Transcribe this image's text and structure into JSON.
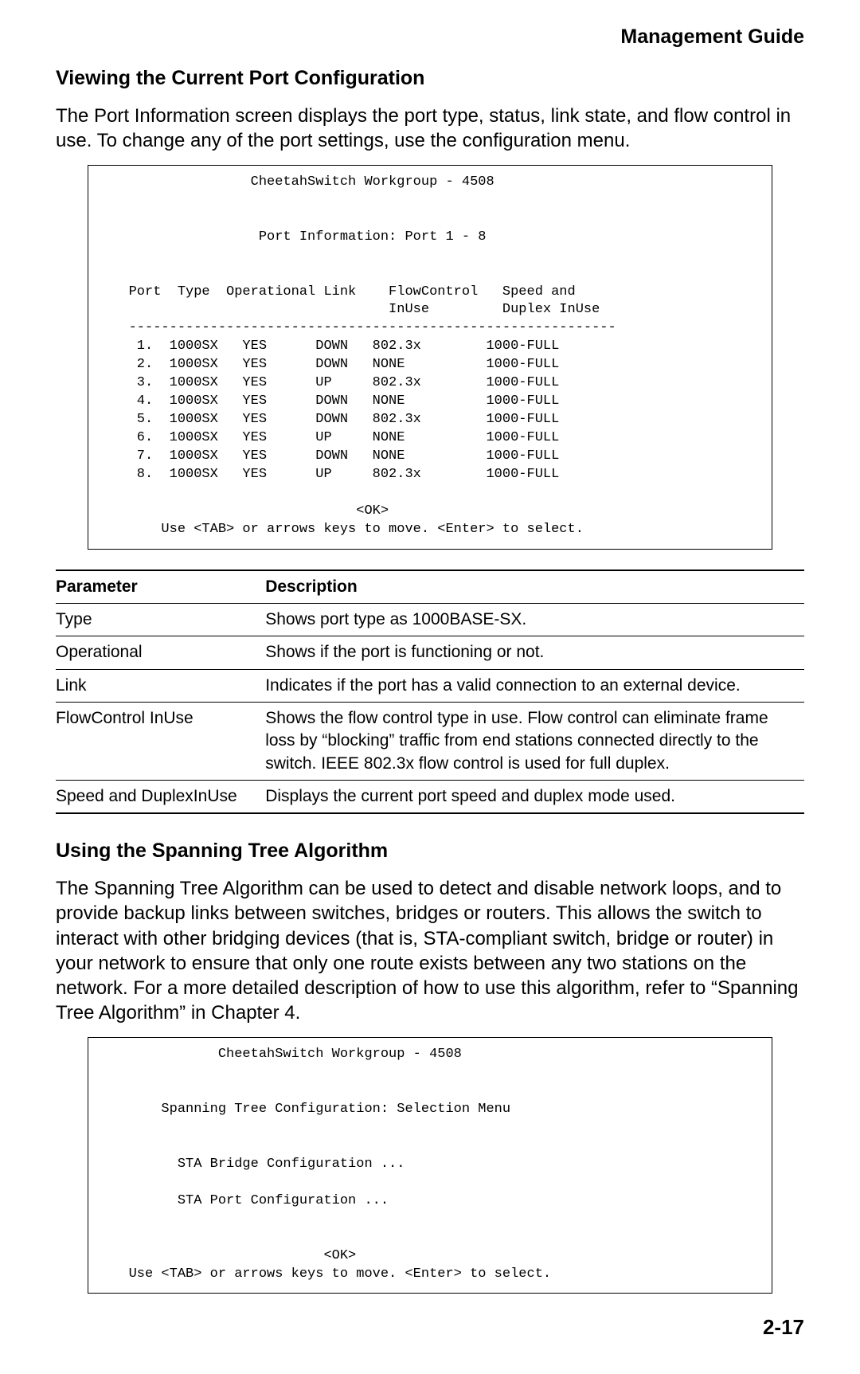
{
  "header": {
    "title": "Management Guide"
  },
  "section1": {
    "heading": "Viewing the Current Port Configuration",
    "paragraph": "The Port Information screen displays the port type, status, link state, and flow control in use. To change any of the port settings, use the configuration menu."
  },
  "terminal1": {
    "title": "CheetahSwitch Workgroup - 4508",
    "subtitle": "Port Information: Port 1 - 8",
    "cols": {
      "c1": "Port",
      "c2": "Type",
      "c3": "Operational",
      "c4": "Link",
      "c5a": "FlowControl",
      "c5b": "InUse",
      "c6a": "Speed and",
      "c6b": "Duplex InUse"
    },
    "rows": [
      {
        "port": "1.",
        "type": "1000SX",
        "op": "YES",
        "link": "DOWN",
        "flow": "802.3x",
        "speed": "1000-FULL"
      },
      {
        "port": "2.",
        "type": "1000SX",
        "op": "YES",
        "link": "DOWN",
        "flow": "NONE",
        "speed": "1000-FULL"
      },
      {
        "port": "3.",
        "type": "1000SX",
        "op": "YES",
        "link": "UP",
        "flow": "802.3x",
        "speed": "1000-FULL"
      },
      {
        "port": "4.",
        "type": "1000SX",
        "op": "YES",
        "link": "DOWN",
        "flow": "NONE",
        "speed": "1000-FULL"
      },
      {
        "port": "5.",
        "type": "1000SX",
        "op": "YES",
        "link": "DOWN",
        "flow": "802.3x",
        "speed": "1000-FULL"
      },
      {
        "port": "6.",
        "type": "1000SX",
        "op": "YES",
        "link": "UP",
        "flow": "NONE",
        "speed": "1000-FULL"
      },
      {
        "port": "7.",
        "type": "1000SX",
        "op": "YES",
        "link": "DOWN",
        "flow": "NONE",
        "speed": "1000-FULL"
      },
      {
        "port": "8.",
        "type": "1000SX",
        "op": "YES",
        "link": "UP",
        "flow": "802.3x",
        "speed": "1000-FULL"
      }
    ],
    "ok": "<OK>",
    "footer": "Use <TAB> or arrows keys to move. <Enter> to select."
  },
  "paramTable": {
    "headers": {
      "param": "Parameter",
      "desc": "Description"
    },
    "rows": [
      {
        "param": "Type",
        "desc": "Shows port type as 1000BASE-SX."
      },
      {
        "param": "Operational",
        "desc": "Shows if the port is functioning or not."
      },
      {
        "param": "Link",
        "desc": "Indicates if the port has a valid connection to an external device."
      },
      {
        "param": "FlowControl InUse",
        "desc": "Shows the flow control type in use. Flow control can eliminate frame loss by “blocking” traffic from end stations connected directly to the switch. IEEE 802.3x flow control is used for full duplex."
      },
      {
        "param": "Speed and DuplexInUse",
        "desc": "Displays the current port speed and duplex mode used."
      }
    ]
  },
  "section2": {
    "heading": "Using the Spanning Tree Algorithm",
    "paragraph": "The Spanning Tree Algorithm can be used to detect and disable network loops, and to provide backup links between switches, bridges or routers. This allows the switch to interact with other bridging devices (that is, STA-compliant switch, bridge or router) in your network to ensure that only one route exists between any two stations on the network. For a more detailed description of how to use this algorithm, refer to “Spanning Tree Algorithm” in Chapter 4."
  },
  "terminal2": {
    "title": "CheetahSwitch Workgroup - 4508",
    "subtitle": "Spanning Tree Configuration: Selection Menu",
    "item1": "STA Bridge Configuration ...",
    "item2": "STA Port Configuration ...",
    "ok": "<OK>",
    "footer": "Use <TAB> or arrows keys to move. <Enter> to select."
  },
  "pageNumber": "2-17"
}
